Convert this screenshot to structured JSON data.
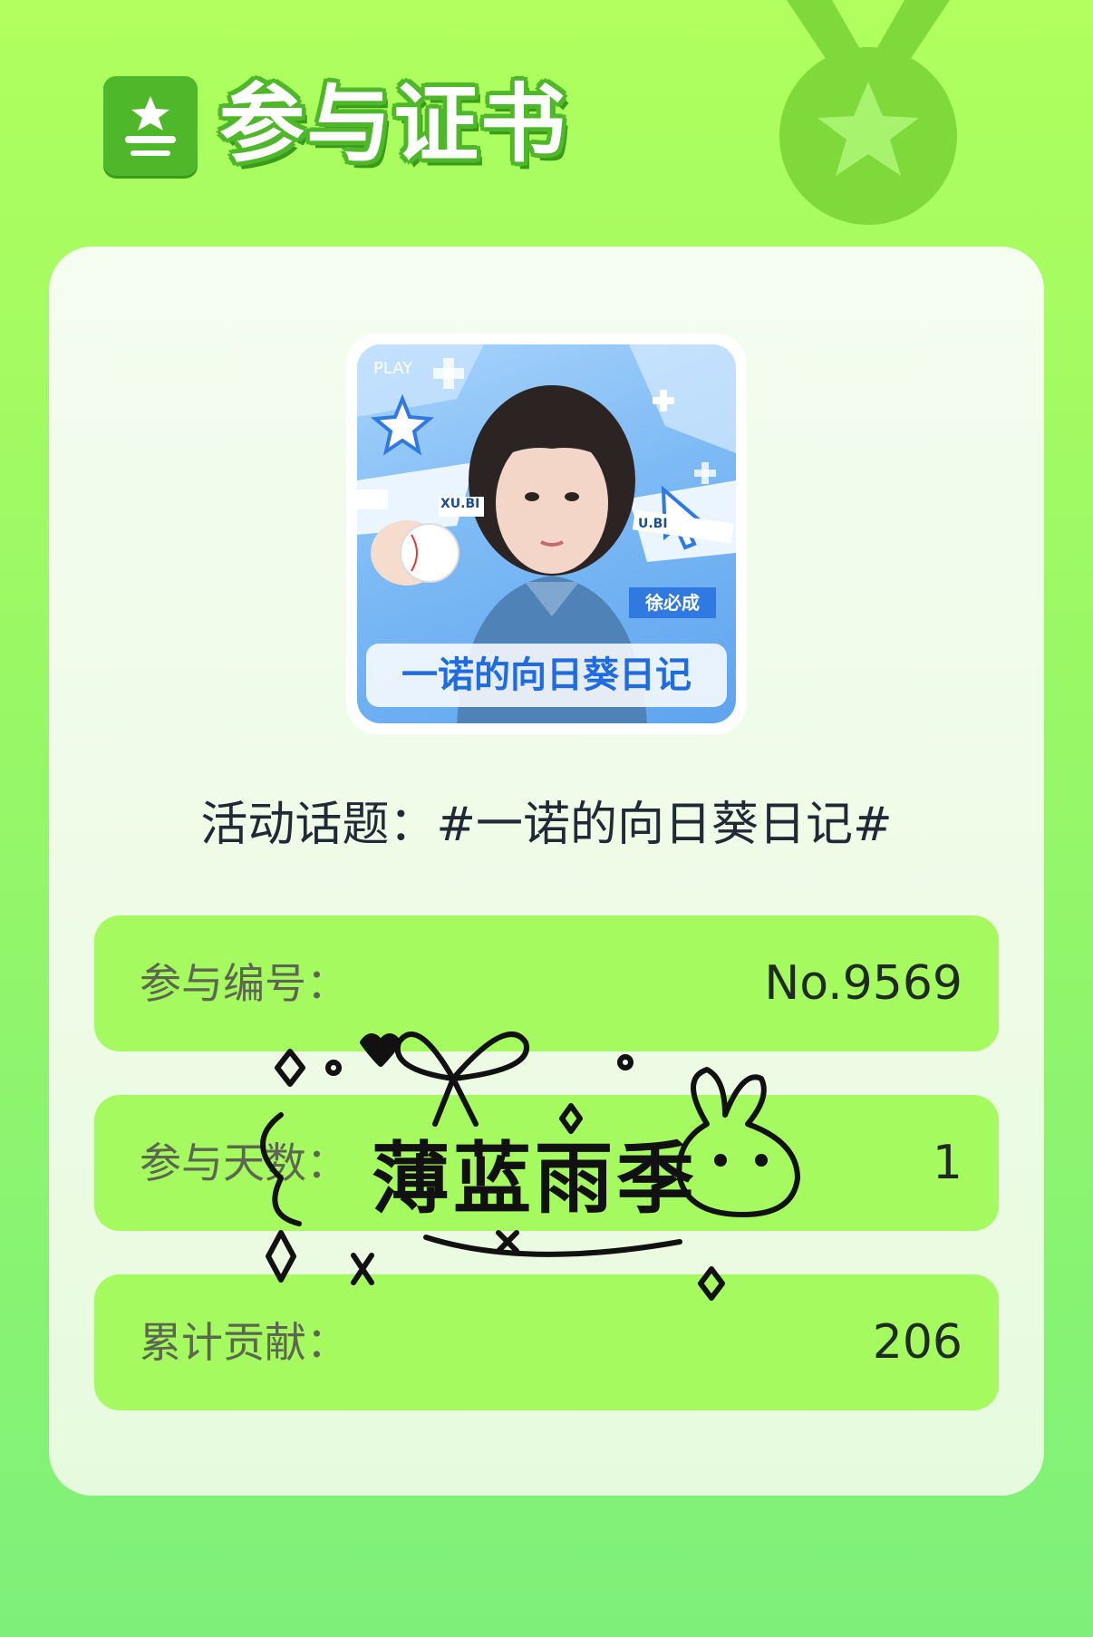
{
  "header": {
    "title": "参与证书"
  },
  "poster": {
    "play_label": "PLAY",
    "tag_name": "徐必成",
    "banner_text": "一诺的向日葵日记",
    "tape_left": "XU.BI",
    "tape_right": "U.BI"
  },
  "topic": {
    "text": "活动话题：#一诺的向日葵日记#"
  },
  "rows": [
    {
      "label": "参与编号：",
      "value": "No.9569"
    },
    {
      "label": "参与天数：",
      "value": "1"
    },
    {
      "label": "累计贡献：",
      "value": "206"
    }
  ],
  "signature": {
    "text": "薄蓝雨季"
  },
  "colors": {
    "bg_top": "#b0ff5e",
    "bg_bottom": "#7ef07a",
    "accent_green": "#4fb82a",
    "row_green": "#a4fa5e",
    "card_bg": "#f4fdf0"
  },
  "icons": {
    "header_logo": "certificate-star-icon",
    "medal": "medal-star-icon"
  }
}
